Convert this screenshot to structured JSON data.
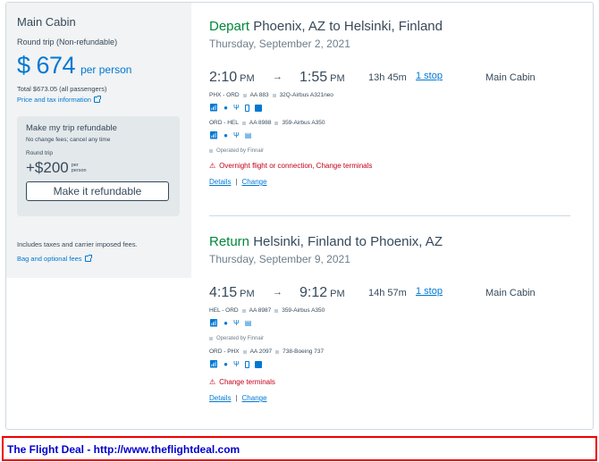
{
  "summary": {
    "cabin": "Main Cabin",
    "trip_type": "Round trip (Non-refundable)",
    "price": "$ 674",
    "per_person": "per person",
    "total": "Total $673.05 (all passengers)",
    "price_tax_link": "Price and tax information",
    "refund": {
      "title": "Make my trip refundable",
      "subtitle": "No change fees; cancel any time",
      "round_trip": "Round trip",
      "price": "+$200",
      "per": "per",
      "person": "person",
      "button": "Make it refundable"
    },
    "includes": "Includes taxes and carrier imposed fees.",
    "bag_link": "Bag and optional fees"
  },
  "depart": {
    "label": "Depart",
    "route": "Phoenix, AZ to Helsinki, Finland",
    "date": "Thursday, September 2, 2021",
    "dep_time": "2:10",
    "dep_ampm": "PM",
    "arrow": "→",
    "arr_time": "1:55",
    "arr_ampm": "PM",
    "duration": "13h  45m",
    "stops": "1 stop",
    "cabin": "Main Cabin",
    "leg1": {
      "route": "PHX - ORD",
      "flight": "AA 883",
      "aircraft": "32Q-Airbus A321neo"
    },
    "leg2": {
      "route": "ORD - HEL",
      "flight": "AA 8988",
      "aircraft": "359-Airbus A350"
    },
    "operated": "Operated by Finnair",
    "warning": "Overnight flight or connection, Change terminals",
    "details": "Details",
    "separator": "|",
    "change": "Change"
  },
  "return": {
    "label": "Return",
    "route": "Helsinki, Finland to Phoenix, AZ",
    "date": "Thursday, September 9, 2021",
    "dep_time": "4:15",
    "dep_ampm": "PM",
    "arrow": "→",
    "arr_time": "9:12",
    "arr_ampm": "PM",
    "duration": "14h  57m",
    "stops": "1 stop",
    "cabin": "Main Cabin",
    "leg1": {
      "route": "HEL - ORD",
      "flight": "AA 8987",
      "aircraft": "359-Airbus A350"
    },
    "operated": "Operated by Finnair",
    "leg2": {
      "route": "ORD - PHX",
      "flight": "AA 2097",
      "aircraft": "738-Boeing 737"
    },
    "warning": "Change terminals",
    "details": "Details",
    "separator": "|",
    "change": "Change"
  },
  "footer": {
    "text": "The Flight Deal - http://www.theflightdeal.com"
  },
  "colors": {
    "accent": "#0078d2",
    "green": "#00873b",
    "warning": "#c30019",
    "footer_border": "#e00000",
    "footer_text": "#0000cc"
  },
  "icons": [
    "wifi-icon",
    "power-icon",
    "usb-icon",
    "phone-entertainment-icon",
    "seatback-screen-icon",
    "warning-icon",
    "external-link-icon"
  ]
}
